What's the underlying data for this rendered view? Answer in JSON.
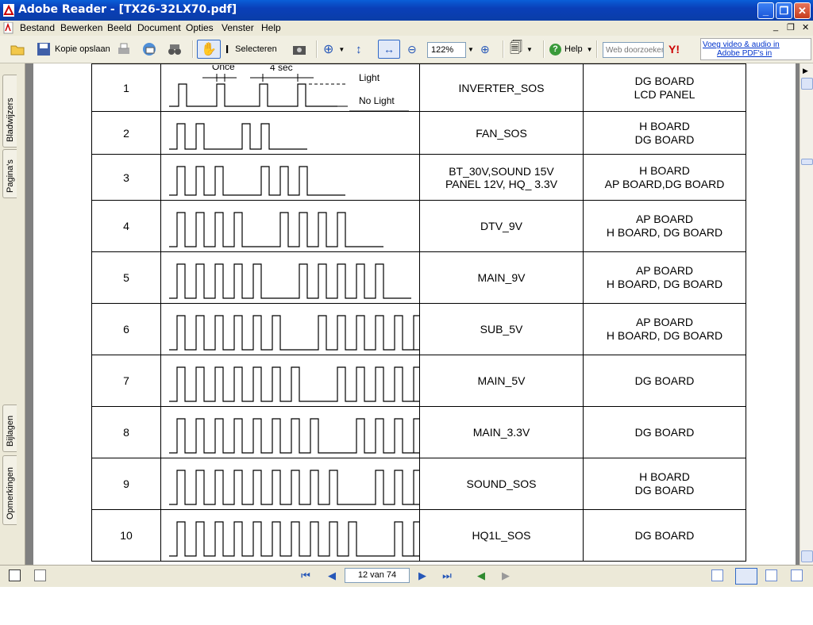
{
  "window": {
    "title": "Adobe Reader - [TX26-32LX70.pdf]"
  },
  "menu": [
    "Bestand",
    "Bewerken",
    "Beeld",
    "Document",
    "Opties",
    "Venster",
    "Help"
  ],
  "toolbar": {
    "save_copy": "Kopie opslaan",
    "select": "Selecteren",
    "zoom_value": "122%",
    "help": "Help",
    "search_placeholder": "Web doorzoeken",
    "promo_line1": "Voeg video & audio in",
    "promo_line2": "Adobe PDF's in"
  },
  "side_tabs": [
    "Bladwijzers",
    "Pagina's",
    "Bijlagen",
    "Opmerkingen"
  ],
  "document": {
    "header_labels": {
      "once": "Once",
      "four_sec": "4 sec",
      "light": "Light",
      "no_light": "No Light"
    },
    "rows": [
      {
        "num": "1",
        "pulses": 1,
        "name_lines": [
          "INVERTER_SOS"
        ],
        "board_lines": [
          "DG BOARD",
          "LCD PANEL"
        ]
      },
      {
        "num": "2",
        "pulses": 2,
        "name_lines": [
          "FAN_SOS"
        ],
        "board_lines": [
          "H BOARD",
          "DG BOARD"
        ]
      },
      {
        "num": "3",
        "pulses": 3,
        "name_lines": [
          "BT_30V,SOUND 15V",
          "PANEL 12V, HQ_ 3.3V"
        ],
        "board_lines": [
          "H BOARD",
          "AP BOARD,DG BOARD"
        ]
      },
      {
        "num": "4",
        "pulses": 4,
        "name_lines": [
          "DTV_9V"
        ],
        "board_lines": [
          "AP BOARD",
          "H BOARD, DG BOARD"
        ]
      },
      {
        "num": "5",
        "pulses": 5,
        "name_lines": [
          "MAIN_9V"
        ],
        "board_lines": [
          "AP BOARD",
          "H BOARD, DG BOARD"
        ]
      },
      {
        "num": "6",
        "pulses": 6,
        "name_lines": [
          "SUB_5V"
        ],
        "board_lines": [
          "AP BOARD",
          "H BOARD, DG BOARD"
        ]
      },
      {
        "num": "7",
        "pulses": 7,
        "name_lines": [
          "MAIN_5V"
        ],
        "board_lines": [
          "DG BOARD"
        ]
      },
      {
        "num": "8",
        "pulses": 8,
        "name_lines": [
          "MAIN_3.3V"
        ],
        "board_lines": [
          "DG BOARD"
        ]
      },
      {
        "num": "9",
        "pulses": 9,
        "name_lines": [
          "SOUND_SOS"
        ],
        "board_lines": [
          "H BOARD",
          "DG BOARD"
        ]
      },
      {
        "num": "10",
        "pulses": 10,
        "name_lines": [
          "HQ1L_SOS"
        ],
        "board_lines": [
          "DG BOARD"
        ]
      }
    ]
  },
  "status": {
    "page_indicator": "12 van 74"
  }
}
